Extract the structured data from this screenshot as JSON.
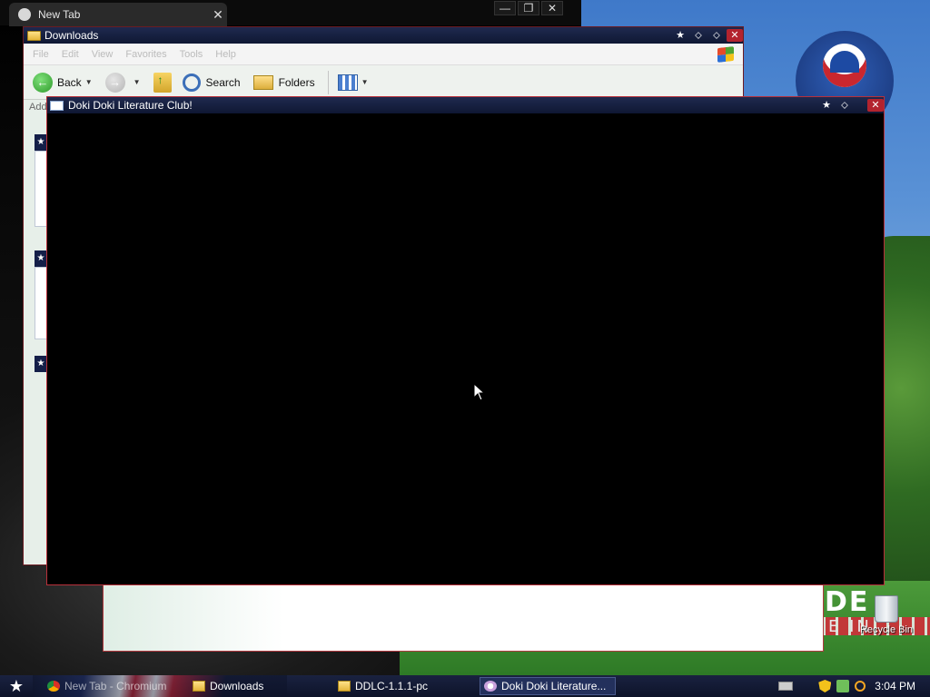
{
  "browser": {
    "tab_title": "New Tab",
    "tab_close": "✕",
    "controls": [
      "—",
      "❐",
      "✕"
    ]
  },
  "explorer": {
    "title": "Downloads",
    "menu": [
      "File",
      "Edit",
      "View",
      "Favorites",
      "Tools",
      "Help"
    ],
    "toolbar": {
      "back_label": "Back",
      "search_label": "Search",
      "folders_label": "Folders"
    },
    "address_label": "Address",
    "side_heads": [
      "★",
      "★",
      "★"
    ]
  },
  "game_window": {
    "title": "Doki Doki Literature Club!"
  },
  "desktop": {
    "recycle_bin_label": "Recycle Bin",
    "banner_text": "DE",
    "banner_sub": "E IN"
  },
  "taskbar": {
    "start_glyph": "★",
    "items": [
      {
        "label": "New Tab - Chromium",
        "icon": "chromium-icon"
      },
      {
        "label": "Downloads",
        "icon": "folder-icon"
      },
      {
        "label": "DDLC-1.1.1-pc",
        "icon": "folder-icon"
      },
      {
        "label": "Doki Doki Literature...",
        "icon": "ddlc-icon"
      }
    ],
    "clock": "3:04 PM"
  },
  "colors": {
    "titlebar": "#1f2a4f",
    "window_border": "#b8303a",
    "taskbar": "#0d1329"
  }
}
